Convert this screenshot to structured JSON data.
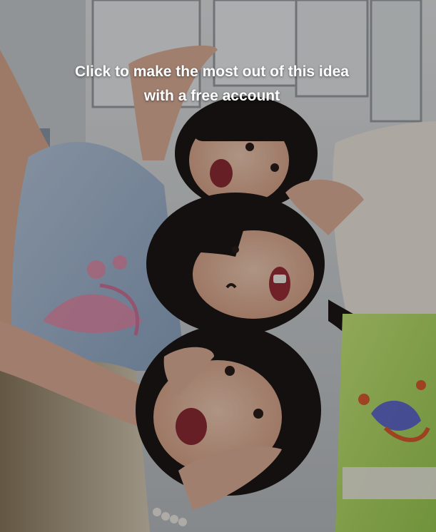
{
  "overlay": {
    "cta_text": "Click to make the most out of this idea with a free account"
  },
  "photo": {
    "subject_icon": "photo-of-three-friends",
    "colors": {
      "background_wall": "#cfd3d6",
      "shirt_blue": "#a9bdd6",
      "shirt_cream": "#efe8e0",
      "shirt_green": "#b9e06a",
      "hair_black": "#1b1716",
      "skin": "#e7b9a0",
      "overlay_dim": "#000000"
    }
  }
}
